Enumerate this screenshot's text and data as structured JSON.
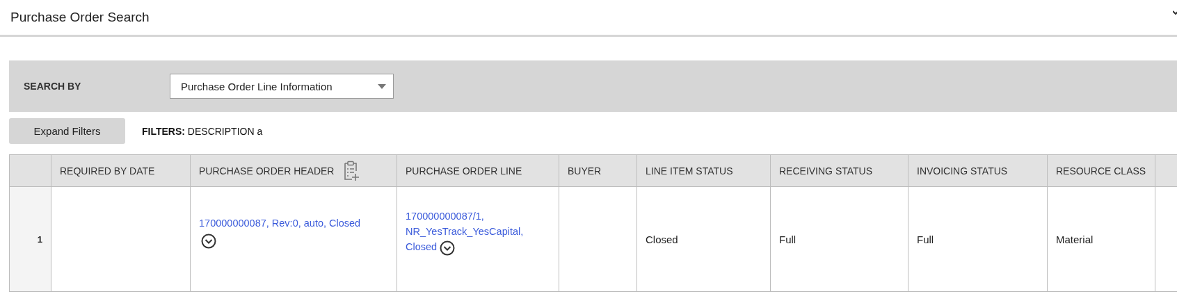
{
  "page": {
    "title": "Purchase Order Search"
  },
  "search_by": {
    "label": "SEARCH BY",
    "value": "Purchase Order Line Information"
  },
  "expand_filters_button": "Expand Filters",
  "filters": {
    "label": "FILTERS:",
    "value": "DESCRIPTION a"
  },
  "table": {
    "columns": [
      {
        "kind": "blank"
      },
      {
        "kind": "text",
        "label": "REQUIRED BY DATE"
      },
      {
        "kind": "text_with_icon",
        "label": "PURCHASE ORDER HEADER"
      },
      {
        "kind": "text",
        "label": "PURCHASE ORDER LINE"
      },
      {
        "kind": "text",
        "label": "BUYER"
      },
      {
        "kind": "text",
        "label": "LINE ITEM STATUS"
      },
      {
        "kind": "text",
        "label": "RECEIVING STATUS"
      },
      {
        "kind": "text",
        "label": "INVOICING STATUS"
      },
      {
        "kind": "text",
        "label": "RESOURCE CLASS"
      },
      {
        "kind": "blank"
      }
    ],
    "rows": [
      {
        "cells": [
          {
            "kind": "index",
            "text": "1"
          },
          {
            "kind": "text",
            "text": ""
          },
          {
            "kind": "link_icon_below",
            "text": "170000000087, Rev:0, auto, Closed"
          },
          {
            "kind": "link",
            "text": "170000000087/1, NR_YesTrack_YesCapital, Closed"
          },
          {
            "kind": "text",
            "text": ""
          },
          {
            "kind": "text",
            "text": "Closed"
          },
          {
            "kind": "text",
            "text": "Full"
          },
          {
            "kind": "text",
            "text": "Full"
          },
          {
            "kind": "text",
            "text": "Material"
          },
          {
            "kind": "text",
            "text": ""
          }
        ]
      }
    ]
  }
}
